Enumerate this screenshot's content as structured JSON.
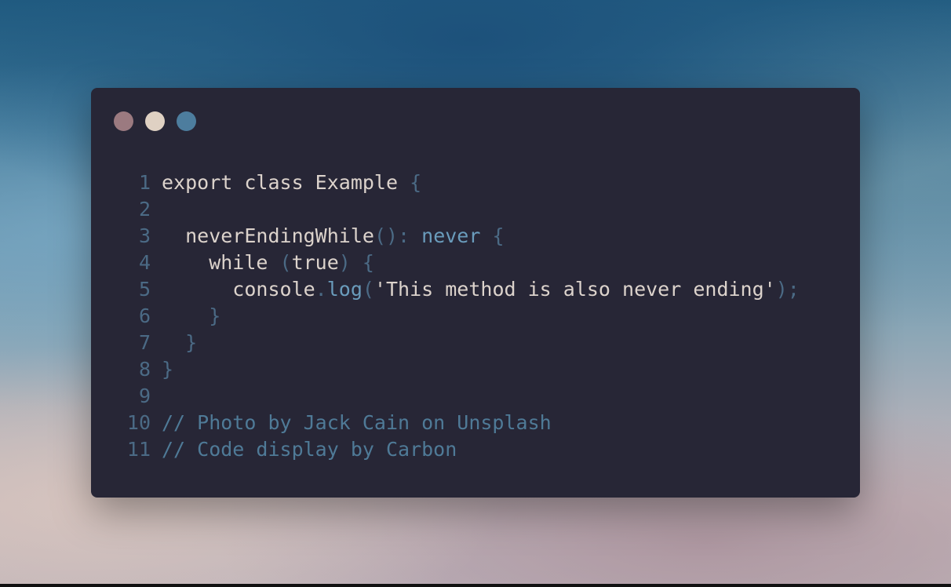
{
  "theme": {
    "window_bg": "#272636",
    "text": "#dcd3cc",
    "keyword": "#6a9cbc",
    "punct": "#4b6a85",
    "comment": "#4f7a97",
    "line_number": "#4b6a85",
    "control_close": "#9b7a80",
    "control_minimize": "#dfd1c3",
    "control_maximize": "#4d7d9e"
  },
  "window_controls": [
    {
      "name": "close",
      "color": "#9b7a80"
    },
    {
      "name": "minimize",
      "color": "#dfd1c3"
    },
    {
      "name": "maximize",
      "color": "#4d7d9e"
    }
  ],
  "code": {
    "lines": [
      {
        "num": "1",
        "tokens": [
          [
            "export class Example ",
            "text"
          ],
          [
            "{",
            "punct"
          ]
        ]
      },
      {
        "num": "2",
        "tokens": []
      },
      {
        "num": "3",
        "tokens": [
          [
            "  neverEndingWhile",
            "text"
          ],
          [
            "()",
            "punct"
          ],
          [
            ": ",
            "punct"
          ],
          [
            "never",
            "keyword"
          ],
          [
            " {",
            "punct"
          ]
        ]
      },
      {
        "num": "4",
        "tokens": [
          [
            "    while ",
            "text"
          ],
          [
            "(",
            "punct"
          ],
          [
            "true",
            "text"
          ],
          [
            ") {",
            "punct"
          ]
        ]
      },
      {
        "num": "5",
        "tokens": [
          [
            "      console",
            "text"
          ],
          [
            ".",
            "punct"
          ],
          [
            "log",
            "keyword"
          ],
          [
            "(",
            "punct"
          ],
          [
            "'This method is also never ending'",
            "text"
          ],
          [
            ");",
            "punct"
          ]
        ]
      },
      {
        "num": "6",
        "tokens": [
          [
            "    }",
            "punct"
          ]
        ]
      },
      {
        "num": "7",
        "tokens": [
          [
            "  }",
            "punct"
          ]
        ]
      },
      {
        "num": "8",
        "tokens": [
          [
            "}",
            "punct"
          ]
        ]
      },
      {
        "num": "9",
        "tokens": []
      },
      {
        "num": "10",
        "tokens": [
          [
            "// Photo by Jack Cain on Unsplash",
            "comment"
          ]
        ]
      },
      {
        "num": "11",
        "tokens": [
          [
            "// Code display by Carbon",
            "comment"
          ]
        ]
      }
    ]
  }
}
